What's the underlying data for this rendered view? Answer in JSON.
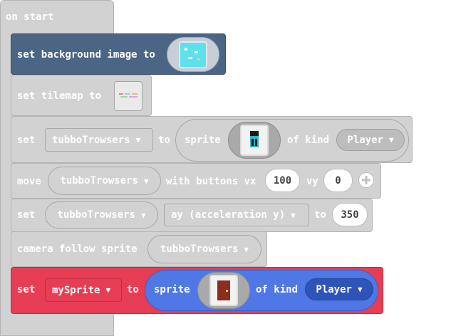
{
  "on_start": {
    "label": "on start"
  },
  "blocks": {
    "set_background": {
      "label": "set background image to",
      "image_name": "background-image-thumbnail"
    },
    "set_tilemap": {
      "label": "set tilemap to",
      "image_name": "tilemap-thumbnail"
    },
    "set_sprite1": {
      "set": "set",
      "variable": "tubboTrowsers",
      "to": "to",
      "sprite": "sprite",
      "of_kind": "of kind",
      "kind": "Player"
    },
    "move": {
      "move": "move",
      "variable": "tubboTrowsers",
      "with_buttons_vx": "with buttons vx",
      "vx": "100",
      "vy_label": "vy",
      "vy": "0"
    },
    "set_accel": {
      "set": "set",
      "variable": "tubboTrowsers",
      "property": "ay (acceleration y)",
      "to": "to",
      "value": "350"
    },
    "camera": {
      "label": "camera follow sprite",
      "variable": "tubboTrowsers"
    },
    "set_sprite2": {
      "set": "set",
      "variable": "mySprite",
      "to": "to",
      "sprite": "sprite",
      "of_kind": "of kind",
      "kind": "Player"
    }
  },
  "colors": {
    "scene_block": "#4b6584",
    "sprite_block": "#4f78e6",
    "sprite_shadow": "#2f54b8",
    "variable_block": "#e63d55",
    "gray_block": "#d2d2d2"
  }
}
